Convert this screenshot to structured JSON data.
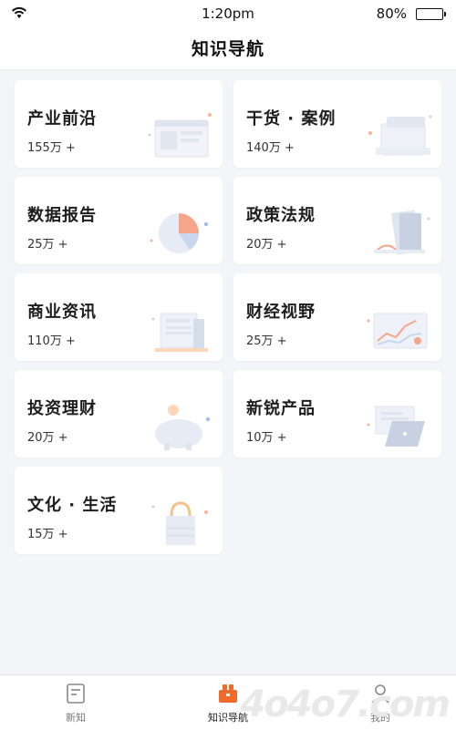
{
  "status_bar": {
    "time": "1:20pm",
    "battery": "80%"
  },
  "header": {
    "title": "知识导航"
  },
  "categories": [
    {
      "name": "产业前沿",
      "count": "155万 +"
    },
    {
      "name": "干货 · 案例",
      "count": "140万 +"
    },
    {
      "name": "数据报告",
      "count": "25万 +"
    },
    {
      "name": "政策法规",
      "count": "20万 +"
    },
    {
      "name": "商业资讯",
      "count": "110万 +"
    },
    {
      "name": "财经视野",
      "count": "25万 +"
    },
    {
      "name": "投资理财",
      "count": "20万 +"
    },
    {
      "name": "新锐产品",
      "count": "10万 +"
    },
    {
      "name": "文化 · 生活",
      "count": "15万 +"
    }
  ],
  "tab_bar": {
    "tabs": [
      {
        "label": "新知",
        "icon": "note-icon"
      },
      {
        "label": "知识导航",
        "icon": "briefcase-icon"
      },
      {
        "label": "我的",
        "icon": "person-icon"
      }
    ],
    "active": "知识导航"
  },
  "watermark": "4o4o7.com",
  "colors": {
    "accent": "#f06a2a",
    "background": "#f4f5f8",
    "card": "#ffffff"
  }
}
